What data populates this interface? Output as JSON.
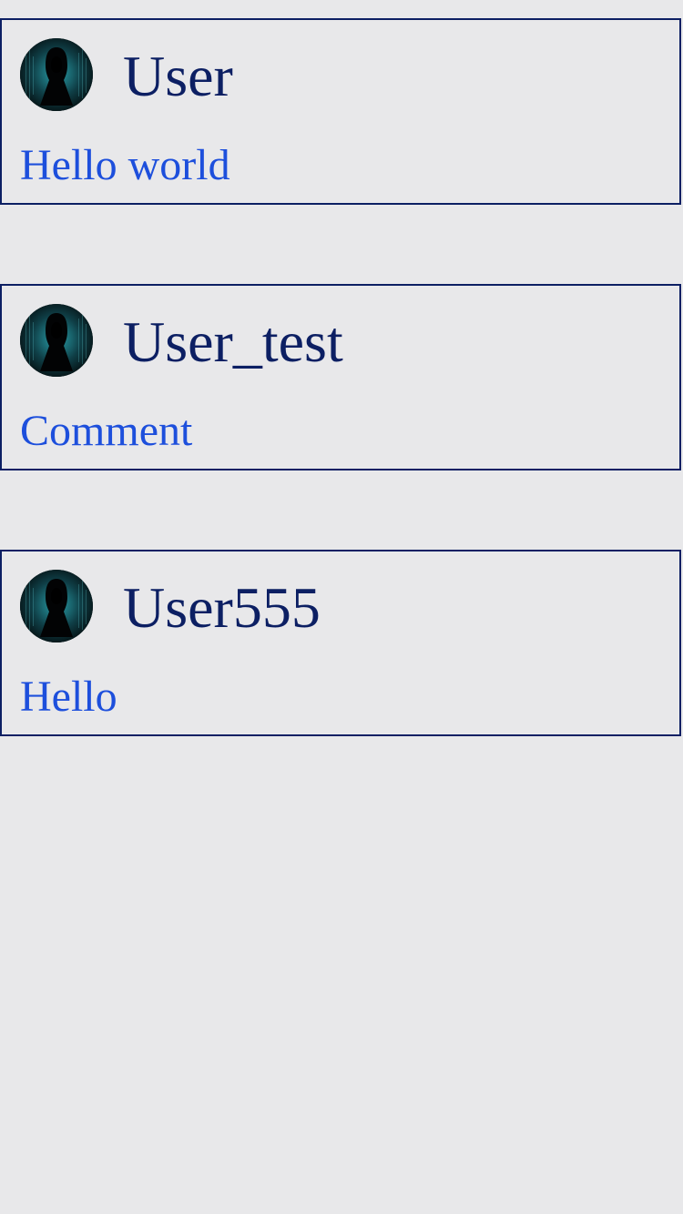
{
  "comments": [
    {
      "username": "User",
      "text": "Hello world",
      "avatar_icon": "hooded-figure-avatar-icon"
    },
    {
      "username": "User_test",
      "text": "Comment",
      "avatar_icon": "hooded-figure-avatar-icon"
    },
    {
      "username": "User555",
      "text": "Hello",
      "avatar_icon": "hooded-figure-avatar-icon"
    }
  ],
  "colors": {
    "background": "#e8e8ea",
    "border": "#0c1f63",
    "username": "#0c1f63",
    "comment_text": "#1d4fdc",
    "avatar_bg": "#061014",
    "avatar_glow": "#1f8f99"
  }
}
